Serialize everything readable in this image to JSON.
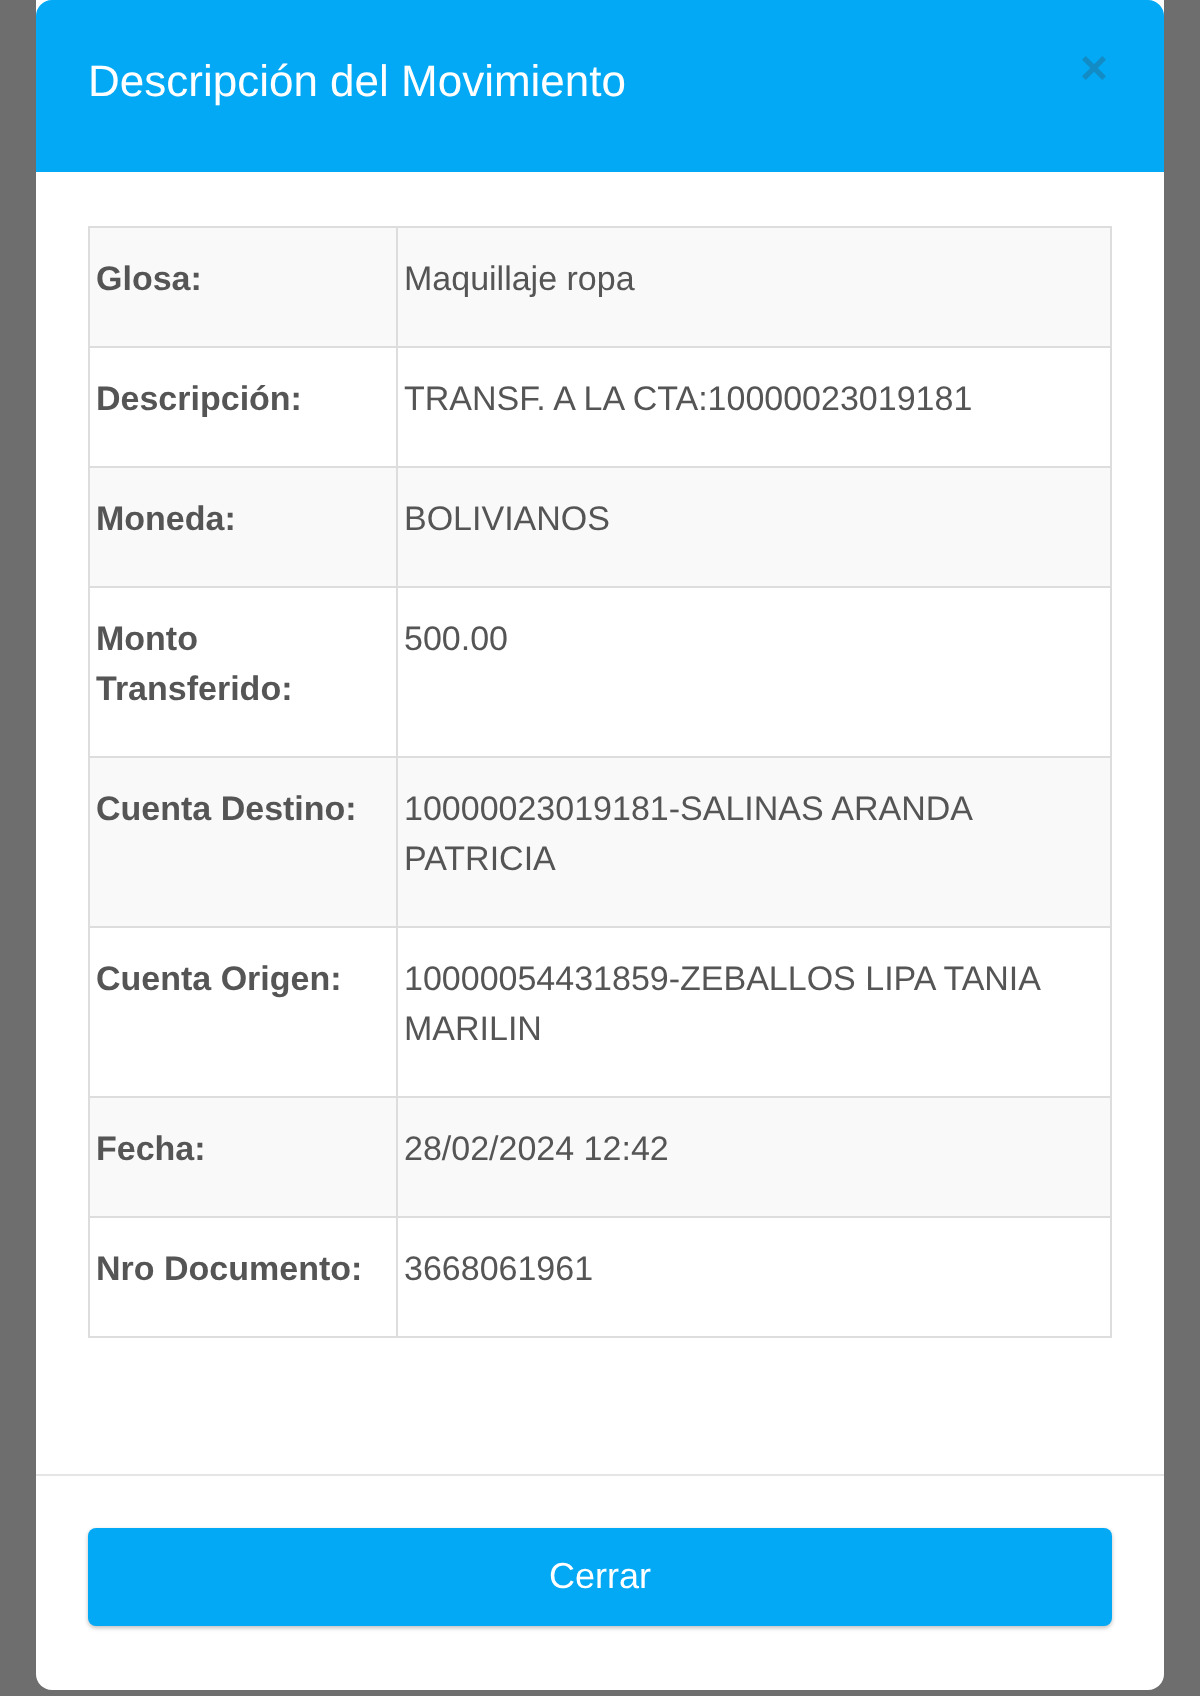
{
  "dialog": {
    "title": "Descripción del Movimiento",
    "close": "×"
  },
  "details": [
    {
      "label": "Glosa:",
      "value": "Maquillaje ropa"
    },
    {
      "label": "Descripción:",
      "value": "TRANSF. A LA CTA:10000023019181"
    },
    {
      "label": "Moneda:",
      "value": "BOLIVIANOS"
    },
    {
      "label": "Monto Transferido:",
      "value": "500.00"
    },
    {
      "label": "Cuenta Destino:",
      "value": "10000023019181-SALINAS ARANDA PATRICIA"
    },
    {
      "label": "Cuenta Origen:",
      "value": "10000054431859-ZEBALLOS LIPA TANIA MARILIN"
    },
    {
      "label": "Fecha:",
      "value": "28/02/2024 12:42"
    },
    {
      "label": "Nro Documento:",
      "value": "3668061961"
    }
  ],
  "footer": {
    "button": "Cerrar"
  }
}
